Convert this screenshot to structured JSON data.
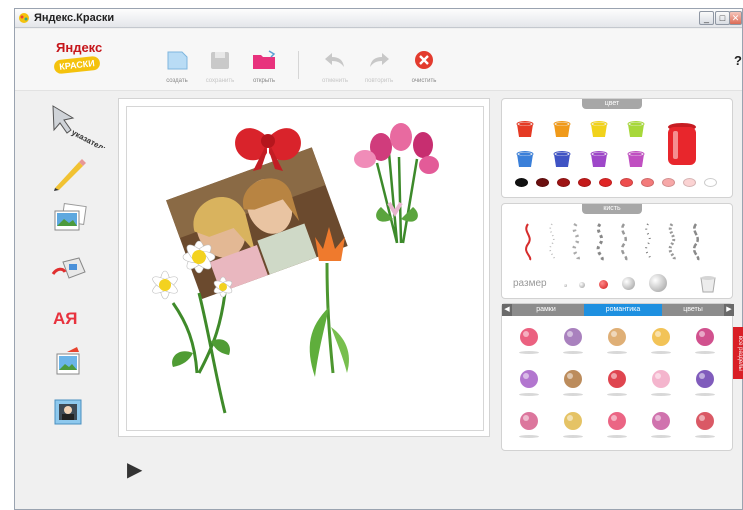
{
  "window": {
    "title": "Яндекс.Краски",
    "controls": {
      "minimize": "_",
      "maximize": "□",
      "close": "✕"
    }
  },
  "logo": {
    "line1": "Яндекс",
    "line2": "КРАСКИ"
  },
  "toolbar": {
    "buttons": [
      {
        "label": "создать",
        "icon": "new-file-icon",
        "enabled": true
      },
      {
        "label": "сохранить",
        "icon": "save-icon",
        "enabled": false
      },
      {
        "label": "открыть",
        "icon": "open-folder-icon",
        "enabled": true
      },
      {
        "label": "отменить",
        "icon": "undo-icon",
        "enabled": false
      },
      {
        "label": "повторить",
        "icon": "redo-icon",
        "enabled": false
      },
      {
        "label": "очистить",
        "icon": "clear-icon",
        "enabled": true
      }
    ],
    "help": "?"
  },
  "tools": [
    {
      "name": "pointer",
      "label": "указатель",
      "icon": "pointer-arrow-icon"
    },
    {
      "name": "pencil",
      "icon": "pencil-icon"
    },
    {
      "name": "photos",
      "icon": "photos-icon"
    },
    {
      "name": "fill",
      "icon": "paint-bucket-icon"
    },
    {
      "name": "text",
      "label": "АЯ",
      "icon": "text-tool-icon"
    },
    {
      "name": "image",
      "icon": "image-tool-icon"
    },
    {
      "name": "frame",
      "icon": "portrait-frame-icon"
    }
  ],
  "color_panel": {
    "title": "цвет",
    "paints": [
      "#e53a24",
      "#f09a1a",
      "#f1d21b",
      "#a7d83a",
      "#3a7fd9",
      "#3f53c4",
      "#9e47c9",
      "#c04fc1"
    ],
    "selected": "#e8262c",
    "swatches": [
      "#111111",
      "#6b0f0f",
      "#9e1414",
      "#c41a1a",
      "#e02626",
      "#ee4e4e",
      "#f37b7b",
      "#f7a8a8",
      "#fbd3d3",
      "#ffffff"
    ]
  },
  "brush_panel": {
    "title": "кисть",
    "brushes": [
      "solid",
      "dots",
      "blobs",
      "stars",
      "dashes",
      "sparkles",
      "diamonds",
      "spirals",
      "twist"
    ],
    "size_label": "размер",
    "sizes": [
      "xs",
      "s",
      "m",
      "l",
      "xl"
    ],
    "selected_size": "m"
  },
  "stickers_panel": {
    "tabs": [
      "рамки",
      "романтика",
      "цветы"
    ],
    "active_tab": "романтика",
    "side_tab": "все разделы",
    "items": [
      "heart-bag-icon",
      "bouquet-icon",
      "boy-icon",
      "candles-icon",
      "girl-icon",
      "glasses-icon",
      "guitar-icon",
      "lips-icon",
      "gift-icon",
      "perfume-icon",
      "couple-icon",
      "photo-frame-icon",
      "heart-card-icon",
      "scooter-icon",
      "wine-glasses-icon"
    ]
  },
  "canvas": {
    "items": [
      "photo",
      "bow",
      "tulip-bouquet",
      "tulip",
      "daisies"
    ]
  },
  "play": "▶"
}
